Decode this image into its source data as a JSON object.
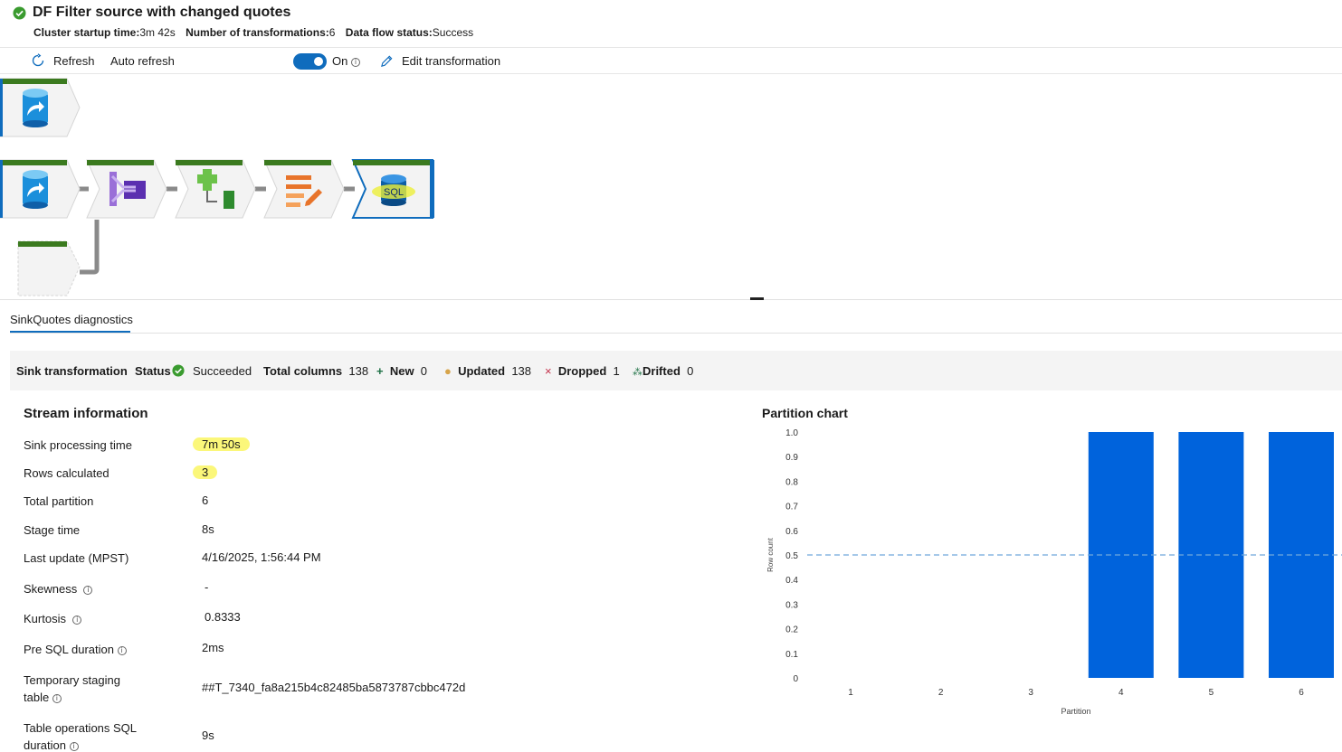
{
  "header": {
    "title": "DF Filter source with changed quotes",
    "cluster_startup_label": "Cluster startup time:",
    "cluster_startup_value": "3m 42s",
    "transformations_label": "Number of transformations:",
    "transformations_value": "6",
    "status_label": "Data flow status:",
    "status_value": "Success"
  },
  "toolbar": {
    "refresh_label": "Refresh",
    "auto_refresh_label": "Auto refresh",
    "toggle_state": "On",
    "edit_label": "Edit transformation"
  },
  "canvas": {
    "nodes": [
      {
        "name": "source-node-1",
        "icon": "database-arrow-icon"
      },
      {
        "name": "source-node-2",
        "icon": "database-arrow-icon"
      },
      {
        "name": "join-node",
        "icon": "join-icon"
      },
      {
        "name": "alter-row-node",
        "icon": "alter-row-icon"
      },
      {
        "name": "select-node",
        "icon": "select-edit-icon"
      },
      {
        "name": "sink-node",
        "icon": "sql-database-icon",
        "label": "SQL"
      },
      {
        "name": "blank-node",
        "icon": ""
      }
    ],
    "accent": "#1e7145",
    "selected_color": "#0f6cbd"
  },
  "tab": {
    "label": "SinkQuotes diagnostics"
  },
  "summary": {
    "sink_label": "Sink transformation",
    "status_label": "Status",
    "status_value": "Succeeded",
    "total_columns_label": "Total columns",
    "total_columns_value": "138",
    "new_label": "New",
    "new_value": "0",
    "updated_label": "Updated",
    "updated_value": "138",
    "dropped_label": "Dropped",
    "dropped_value": "1",
    "drifted_label": "Drifted",
    "drifted_value": "0"
  },
  "stream": {
    "title": "Stream information",
    "rows": [
      {
        "label": "Sink processing time",
        "value": "7m 50s",
        "info": false,
        "highlight": true
      },
      {
        "label": "Rows calculated",
        "value": "3",
        "info": false,
        "highlight": true
      },
      {
        "label": "Total partition",
        "value": "6",
        "info": false
      },
      {
        "label": "Stage time",
        "value": "8s",
        "info": false
      },
      {
        "label": "Last update (MPST)",
        "value": "4/16/2025, 1:56:44 PM",
        "info": false
      },
      {
        "label": "Skewness",
        "value": "-",
        "info": true
      },
      {
        "label": "Kurtosis",
        "value": "0.8333",
        "info": true
      },
      {
        "label": "Pre SQL duration",
        "value": "2ms",
        "info": true
      },
      {
        "label_line1": "Temporary staging",
        "label_line2": "table",
        "value": "##T_7340_fa8a215b4c82485ba5873787cbbc472d",
        "info": true
      },
      {
        "label_line1": "Table operations SQL",
        "label_line2": "duration",
        "value": "9s",
        "info": true
      }
    ]
  },
  "chart_data": {
    "type": "bar",
    "title": "Partition chart",
    "xlabel": "Partition",
    "ylabel": "Row count",
    "categories": [
      "1",
      "2",
      "3",
      "4",
      "5",
      "6"
    ],
    "values": [
      0,
      0,
      0,
      1,
      1,
      1
    ],
    "ylim": [
      0,
      1
    ],
    "yticks": [
      "0",
      "0.1",
      "0.2",
      "0.3",
      "0.4",
      "0.5",
      "0.6",
      "0.7",
      "0.8",
      "0.9",
      "1.0"
    ],
    "reference_line": 0.5,
    "bar_color": "#0063dc",
    "reference_color": "#6fa8dc",
    "grid": false
  }
}
